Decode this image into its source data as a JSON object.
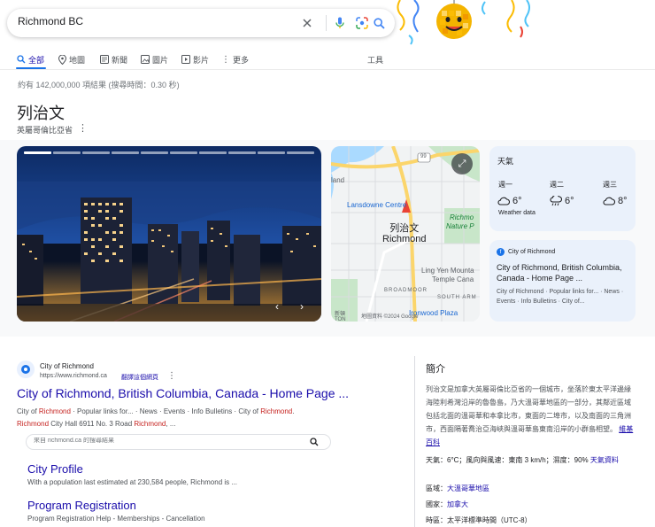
{
  "search": {
    "query": "Richmond BC"
  },
  "tabs": [
    {
      "label": "全部",
      "icon": "search-icon"
    },
    {
      "label": "地圖",
      "icon": "map-pin-icon"
    },
    {
      "label": "新聞",
      "icon": "news-icon"
    },
    {
      "label": "圖片",
      "icon": "image-icon"
    },
    {
      "label": "影片",
      "icon": "video-icon"
    },
    {
      "label": "更多",
      "icon": "more-icon"
    }
  ],
  "tools_label": "工具",
  "result_stats": "約有 142,000,000 項結果 (搜尋時間：0.30 秒)",
  "entity": {
    "title": "列治文",
    "subtitle": "英屬哥倫比亞省"
  },
  "map": {
    "labels": {
      "highway": "99",
      "island": "land",
      "lansdowne": "Lansdowne Centre",
      "nature1": "Richmo",
      "nature2": "Nature P",
      "temple1": "Ling Yen Mounta",
      "temple2": "Temple Cana",
      "broadmoor": "BROADMOOR",
      "southarm": "SOUTH ARM",
      "ironwood": "Ironwood Plaza",
      "bottom_left": "新頓\nTON"
    },
    "city_line1": "列治文",
    "city_line2": "Richmond",
    "credit": "地圖資料 ©2024 Google"
  },
  "weather": {
    "title": "天氣",
    "days": [
      {
        "day": "週一",
        "temp": "6°",
        "icon": "cloud-icon"
      },
      {
        "day": "週二",
        "temp": "6°",
        "icon": "cloud-rain-icon"
      },
      {
        "day": "週三",
        "temp": "8°",
        "icon": "cloud-icon"
      }
    ],
    "data_label": "Weather data"
  },
  "site_card": {
    "name": "City of Richmond",
    "title": "City of Richmond, British Columbia, Canada - Home Page ...",
    "links": "City of Richmond · Popular links for... · News · Events · Info Bulletins · City of..."
  },
  "result": {
    "site_name": "City of Richmond",
    "url": "https://www.richmond.ca",
    "translate": "翻譯這個網頁",
    "title": "City of Richmond, British Columbia, Canada - Home Page ...",
    "snippet_a": "City of ",
    "snippet_hl1": "Richmond",
    "snippet_b": " · Popular links for... · News · Events · Info Bulletins · City of ",
    "snippet_hl2": "Richmond",
    "snippet_c": ".",
    "snippet_hl3": "Richmond",
    "snippet_d": " City Hall 6911 No. 3 Road ",
    "snippet_hl4": "Richmond",
    "snippet_e": ", ..."
  },
  "site_search": {
    "placeholder": "來自 richmond.ca 的搜尋結果"
  },
  "sitelinks": [
    {
      "title": "City Profile",
      "desc": "With a population last estimated at 230,584 people, Richmond is ..."
    },
    {
      "title": "Program Registration",
      "desc": "Program Registration Help - Memberships - Cancellation"
    }
  ],
  "about": {
    "title": "簡介",
    "text": "列治文是加拿大英屬哥倫比亞省的一個城市，坐落於東太平洋邊緣海陸利希灣沿岸的魯魯島，乃大溫哥華地區的一部分，其鄰近區域包括北面的溫哥華和本拿比市，東面的二埠市，以及南面的三角洲市，西面隔著喬治亞海峽與溫哥華島東南沿岸的小群島相望。",
    "wiki_link": "維基百科"
  },
  "facts": {
    "weather_key": "天氣：",
    "weather_val": "6°C；風向與風速：東南 3 km/h；濕度：90%",
    "weather_link": "天氣資料",
    "region_key": "區域：",
    "region_val": "大溫哥華地區",
    "country_key": "國家：",
    "country_val": "加拿大",
    "tz_key": "時區：",
    "tz_val": "太平洋標準時間（UTC-8）"
  },
  "colors": {
    "link": "#1a0dab",
    "accent": "#1a73e8",
    "card": "#eaf1fb",
    "highlight": "#c5221f"
  }
}
